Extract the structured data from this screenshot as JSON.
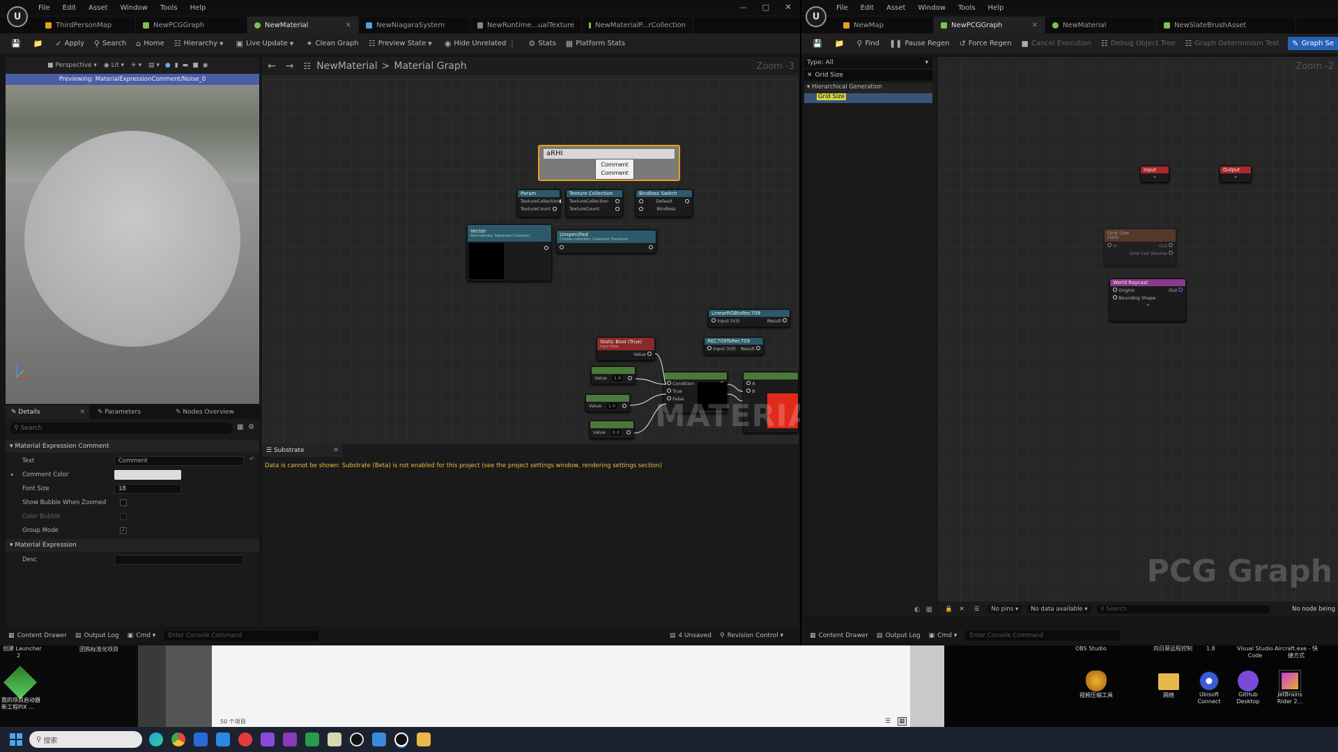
{
  "left_window": {
    "menu": [
      "File",
      "Edit",
      "Asset",
      "Window",
      "Tools",
      "Help"
    ],
    "tabs": [
      {
        "label": "ThirdPersonMap",
        "color": "#e8a020",
        "active": false
      },
      {
        "label": "NewPCGGraph",
        "color": "#7dc24b",
        "active": false
      },
      {
        "label": "NewMaterial",
        "color": "#7dc24b",
        "active": true
      },
      {
        "label": "NewNiagaraSystem",
        "color": "#4aa3d8",
        "active": false
      },
      {
        "label": "NewRuntime...ualTexture",
        "color": "#888888",
        "active": false
      },
      {
        "label": "NewMaterialP...rCollection",
        "color": "#7dc24b",
        "active": false
      }
    ],
    "toolbar": [
      "Apply",
      "Search",
      "Home",
      "Hierarchy",
      "Live Update",
      "Clean Graph",
      "Preview State",
      "Hide Unrelated",
      "Stats",
      "Platform Stats"
    ],
    "viewport": {
      "perspective": "Perspective",
      "lit": "Lit",
      "banner": "Previewing: MaterialExpressionComment/Noise_0"
    },
    "graph": {
      "breadcrumb_root": "NewMaterial",
      "breadcrumb_sep": ">",
      "breadcrumb_leaf": "Material Graph",
      "zoom": "Zoom -3",
      "watermark": "MATERIAL",
      "comment_text": "aRHI",
      "tooltip_line1": "Comment",
      "tooltip_line2": "Comment",
      "nodes": {
        "param": "Param",
        "tex_collection": "Texture Collection",
        "bindless": "Bindless Switch",
        "texture_collection_pin": "TextureCollection",
        "texture_count_pin": "TextureCount",
        "default_pin": "Default",
        "bindless_pin": "Bindless",
        "vector": "Vector",
        "vector_sub": "Alternatively: Substrate Collection",
        "unspecified": "Unspecified",
        "unspecified_sub": "Choose collection, Collection Transform",
        "linear_to_rec": "LinearRGBtoRec709",
        "rec_to_linear": "REC709ToRec709",
        "static_bool": "Static Bool (True)",
        "static_bool_sub": "Input Data",
        "value": "Value",
        "input": "Input (V3)",
        "result": "Result",
        "condition": "Condition",
        "true": "True",
        "false": "False",
        "a": "A",
        "b": "B",
        "val1": "1.0",
        "val2": "1.0",
        "val3": "0.0"
      }
    },
    "details": {
      "tabs": [
        "Details",
        "Parameters",
        "Nodes Overview"
      ],
      "search_placeholder": "Search",
      "section1": "Material Expression Comment",
      "rows": [
        {
          "label": "Text",
          "value": "Comment"
        },
        {
          "label": "Comment Color",
          "value": ""
        },
        {
          "label": "Font Size",
          "value": "18"
        },
        {
          "label": "Show Bubble When Zoomed",
          "value": ""
        },
        {
          "label": "Color Bubble",
          "value": ""
        },
        {
          "label": "Group Mode",
          "value": ""
        }
      ],
      "section2": "Material Expression",
      "desc_label": "Desc"
    },
    "substrate": {
      "title": "Substrate",
      "message": "Data is cannot be shown: Substrate (Beta) is not enabled for this project (see the project settings window, rendering settings section)"
    },
    "status": {
      "content_drawer": "Content Drawer",
      "output_log": "Output Log",
      "cmd": "Cmd",
      "console_placeholder": "Enter Console Command",
      "unsaved": "4 Unsaved",
      "revision": "Revision Control"
    }
  },
  "right_window": {
    "menu": [
      "File",
      "Edit",
      "Asset",
      "Window",
      "Tools",
      "Help"
    ],
    "tabs": [
      {
        "label": "NewMap",
        "color": "#e8a020",
        "active": false
      },
      {
        "label": "NewPCGGraph",
        "color": "#7dc24b",
        "active": true
      },
      {
        "label": "NewMaterial",
        "color": "#7dc24b",
        "active": false
      },
      {
        "label": "NewSlateBrushAsset",
        "color": "#7dc24b",
        "active": false
      }
    ],
    "toolbar": [
      "Find",
      "Pause Regen",
      "Force Regen",
      "Cancel Execution",
      "Debug Object Tree",
      "Graph Determinism Test",
      "Graph Se"
    ],
    "palette": {
      "type_label": "Type:",
      "type_value": "All",
      "search_value": "Grid Size",
      "category": "Hierarchical Generation",
      "item": "Grid Size"
    },
    "graph": {
      "zoom": "Zoom -2",
      "watermark": "PCG Graph",
      "input": "Input",
      "output": "Output",
      "grid_size": "Grid Size",
      "grid_size_sub": "25600",
      "in": "In",
      "out": "Out",
      "grid_cell_volume": "Grid Cell Volume",
      "world_raycast": "World Raycast",
      "origins": "Origins",
      "bounding_shape": "Bounding Shape"
    },
    "attr": {
      "no_pins": "No pins",
      "no_data": "No data available",
      "search_placeholder": "Search",
      "no_node": "No node being"
    },
    "status": {
      "content_drawer": "Content Drawer",
      "output_log": "Output Log",
      "cmd": "Cmd",
      "console_placeholder": "Enter Console Command"
    }
  },
  "desktop": {
    "left_icon_top": "创建 Launcher",
    "left_icon_top2": "2",
    "left_icon_col2": "团购标准化项目",
    "left_icon_label": "我的项目启动器",
    "left_icon_label2": "新工程PIX ...",
    "folder_count": "50 个项目",
    "right_top_labels": [
      "OBS Studio",
      "向日葵远程控制",
      "1.8",
      "Visual Studio Code",
      "Aircraft.exe - 快捷方式"
    ],
    "icons": [
      {
        "label": "视频压缩工具",
        "label2": ""
      },
      {
        "label": "网络",
        "label2": ""
      },
      {
        "label": "Ubisoft",
        "label2": "Connect"
      },
      {
        "label": "GitHub",
        "label2": "Desktop"
      },
      {
        "label": "JetBrains",
        "label2": "Rider 2..."
      }
    ]
  },
  "taskbar": {
    "search_placeholder": "搜索"
  }
}
